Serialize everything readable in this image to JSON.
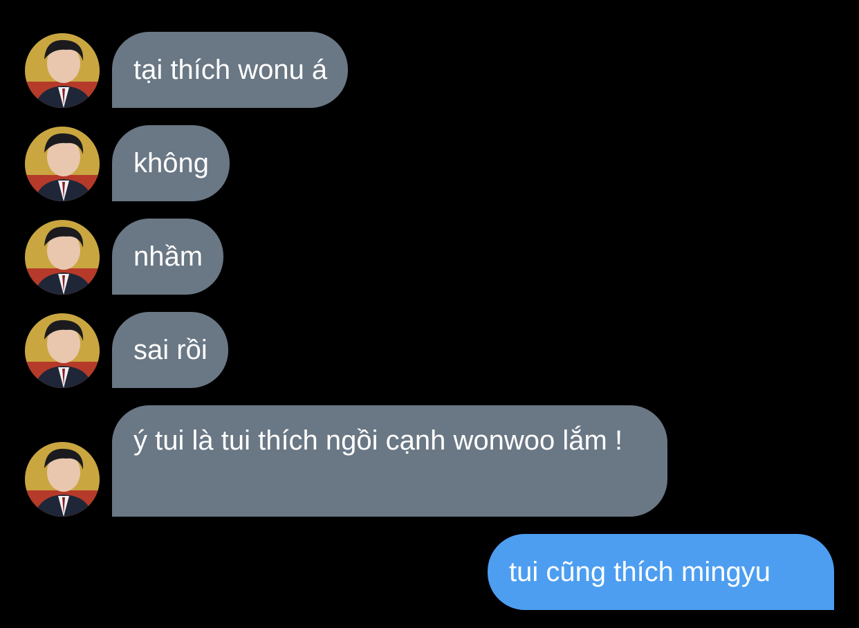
{
  "conversation": {
    "received": [
      {
        "text": "tại thích wonu á"
      },
      {
        "text": "không"
      },
      {
        "text": "nhầm"
      },
      {
        "text": "sai rồi"
      },
      {
        "text": "ý tui là tui thích ngồi cạnh wonwoo lắm !"
      }
    ],
    "sent": [
      {
        "text": "tui cũng thích mingyu"
      }
    ]
  },
  "colors": {
    "background": "#000000",
    "received_bubble": "#6a7784",
    "sent_bubble": "#4d9ef0",
    "text": "#ffffff"
  },
  "icons": {
    "avatar": "profile-photo-avatar"
  }
}
